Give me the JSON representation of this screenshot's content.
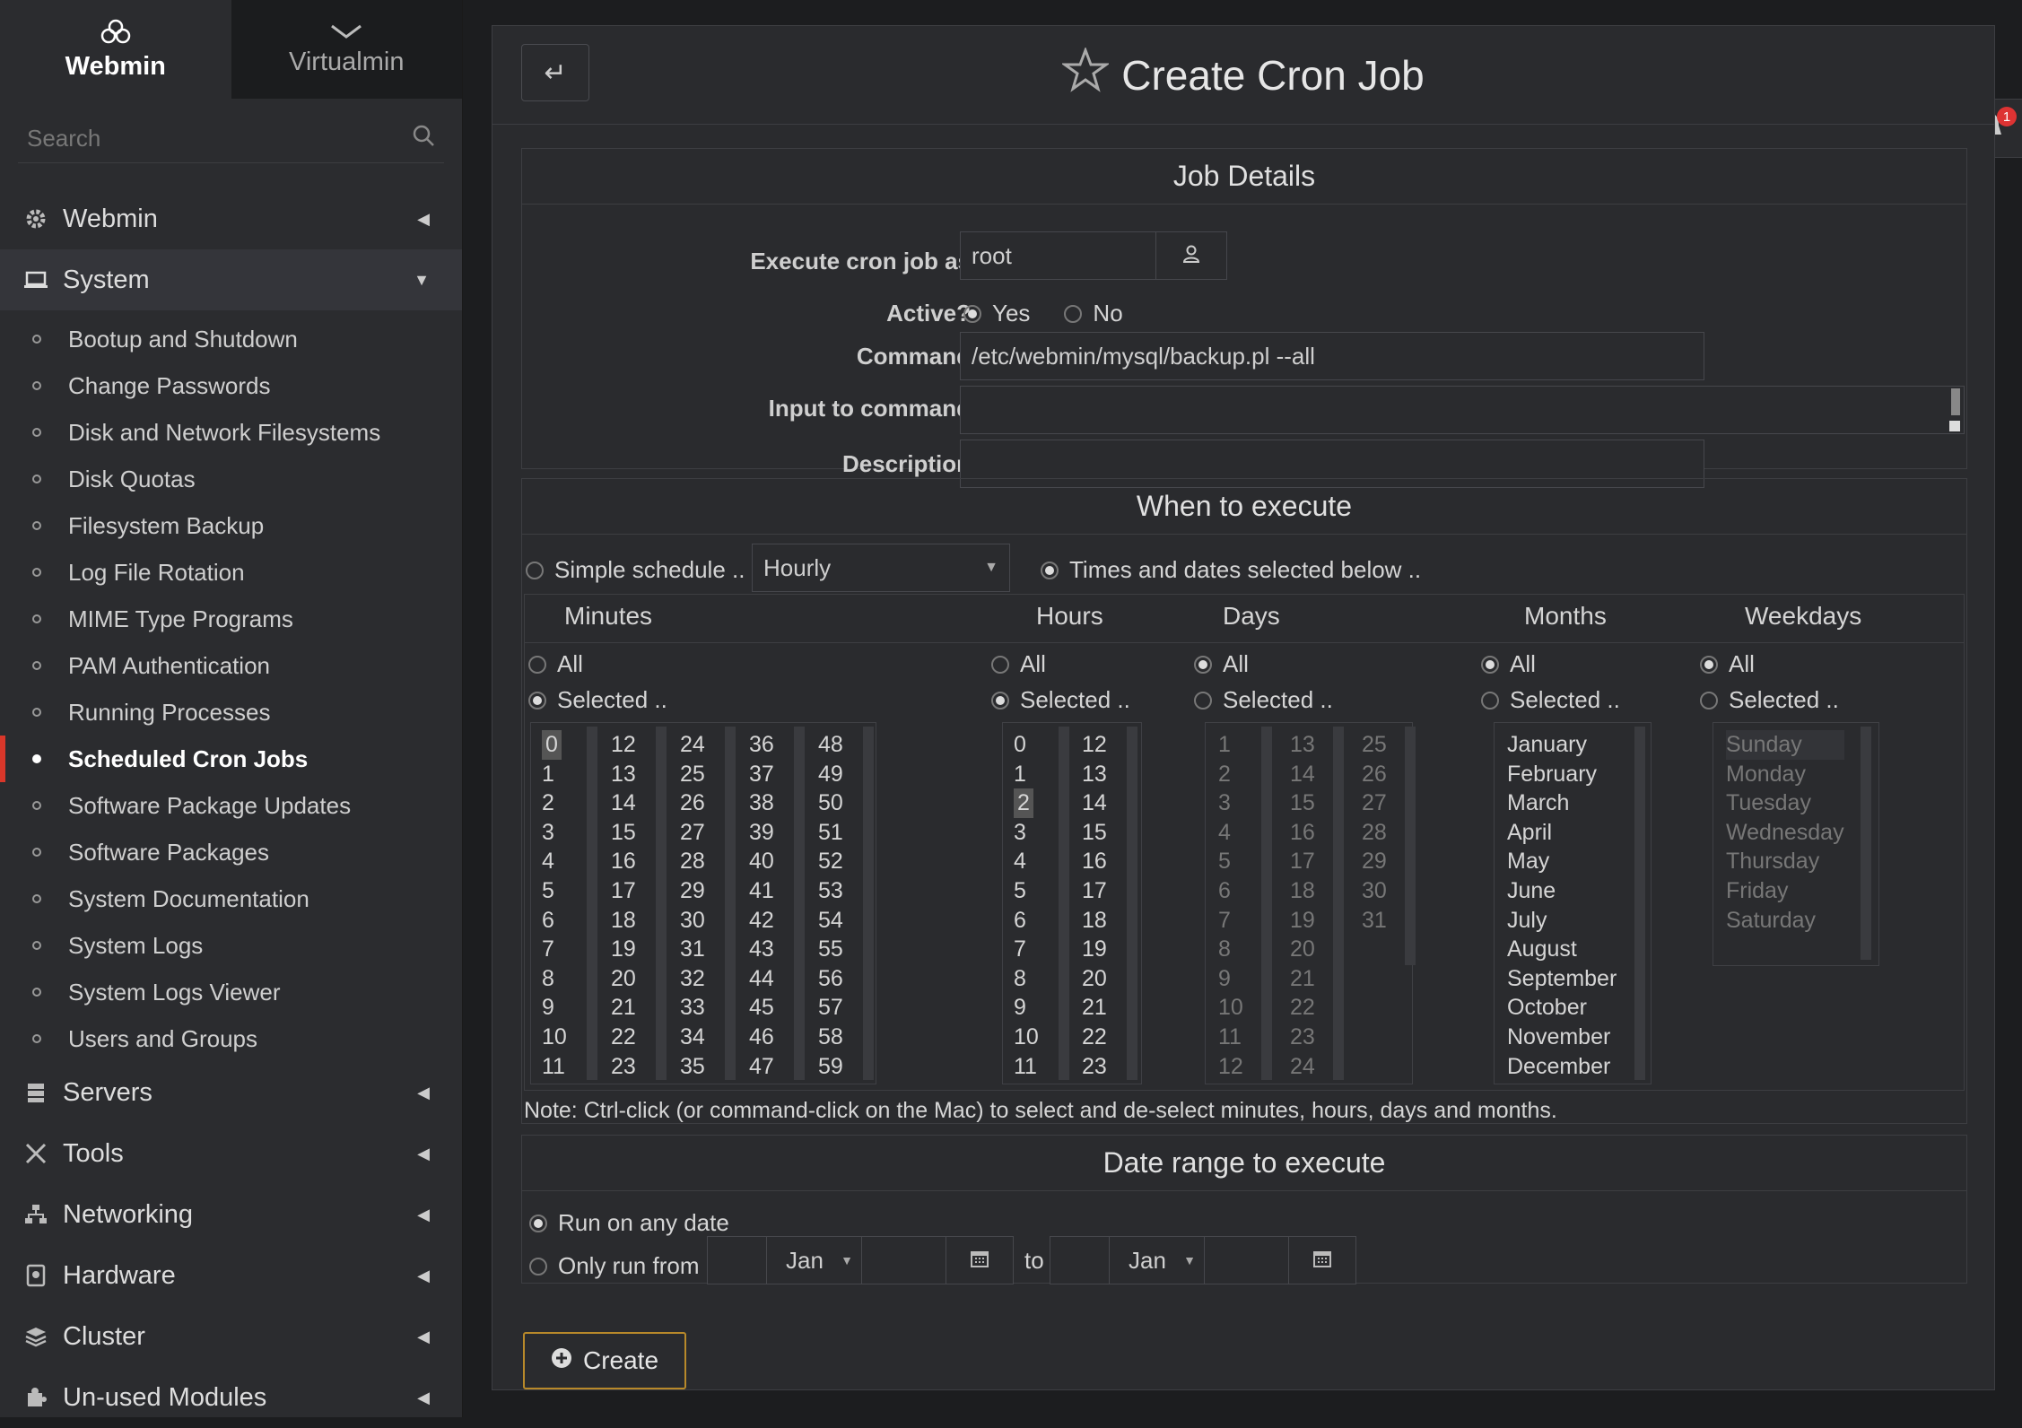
{
  "switcher": {
    "webmin": "Webmin",
    "virtualmin": "Virtualmin"
  },
  "search": {
    "placeholder": "Search"
  },
  "menu": {
    "webmin": "Webmin",
    "system": "System",
    "system_items": [
      "Bootup and Shutdown",
      "Change Passwords",
      "Disk and Network Filesystems",
      "Disk Quotas",
      "Filesystem Backup",
      "Log File Rotation",
      "MIME Type Programs",
      "PAM Authentication",
      "Running Processes",
      "Scheduled Cron Jobs",
      "Software Package Updates",
      "Software Packages",
      "System Documentation",
      "System Logs",
      "System Logs Viewer",
      "Users and Groups"
    ],
    "active_item": "Scheduled Cron Jobs",
    "servers": "Servers",
    "tools": "Tools",
    "networking": "Networking",
    "hardware": "Hardware",
    "cluster": "Cluster",
    "unused": "Un-used Modules"
  },
  "page": {
    "title": "Create Cron Job",
    "notifications": "1"
  },
  "job": {
    "section": "Job Details",
    "exec_as_label": "Execute cron job as",
    "exec_as_value": "root",
    "active_label": "Active?",
    "yes": "Yes",
    "no": "No",
    "command_label": "Command",
    "command_value": "/etc/webmin/mysql/backup.pl --all",
    "input_label": "Input to command",
    "description_label": "Description"
  },
  "when": {
    "section": "When to execute",
    "simple": "Simple schedule ..",
    "simple_value": "Hourly",
    "times": "Times and dates selected below ..",
    "headers": {
      "minutes": "Minutes",
      "hours": "Hours",
      "days": "Days",
      "months": "Months",
      "weekdays": "Weekdays"
    },
    "all": "All",
    "selected": "Selected ..",
    "minutes_cols": [
      [
        "0",
        "1",
        "2",
        "3",
        "4",
        "5",
        "6",
        "7",
        "8",
        "9",
        "10",
        "11"
      ],
      [
        "12",
        "13",
        "14",
        "15",
        "16",
        "17",
        "18",
        "19",
        "20",
        "21",
        "22",
        "23"
      ],
      [
        "24",
        "25",
        "26",
        "27",
        "28",
        "29",
        "30",
        "31",
        "32",
        "33",
        "34",
        "35"
      ],
      [
        "36",
        "37",
        "38",
        "39",
        "40",
        "41",
        "42",
        "43",
        "44",
        "45",
        "46",
        "47"
      ],
      [
        "48",
        "49",
        "50",
        "51",
        "52",
        "53",
        "54",
        "55",
        "56",
        "57",
        "58",
        "59"
      ]
    ],
    "hours_cols": [
      [
        "0",
        "1",
        "2",
        "3",
        "4",
        "5",
        "6",
        "7",
        "8",
        "9",
        "10",
        "11"
      ],
      [
        "12",
        "13",
        "14",
        "15",
        "16",
        "17",
        "18",
        "19",
        "20",
        "21",
        "22",
        "23"
      ]
    ],
    "days_cols": [
      [
        "1",
        "2",
        "3",
        "4",
        "5",
        "6",
        "7",
        "8",
        "9",
        "10",
        "11",
        "12"
      ],
      [
        "13",
        "14",
        "15",
        "16",
        "17",
        "18",
        "19",
        "20",
        "21",
        "22",
        "23",
        "24"
      ],
      [
        "25",
        "26",
        "27",
        "28",
        "29",
        "30",
        "31"
      ]
    ],
    "months": [
      "January",
      "February",
      "March",
      "April",
      "May",
      "June",
      "July",
      "August",
      "September",
      "October",
      "November",
      "December"
    ],
    "weekdays": [
      "Sunday",
      "Monday",
      "Tuesday",
      "Wednesday",
      "Thursday",
      "Friday",
      "Saturday"
    ],
    "selected_minute": "0",
    "selected_hour": "2",
    "note": "Note: Ctrl-click (or command-click on the Mac) to select and de-select minutes, hours, days and months."
  },
  "range": {
    "section": "Date range to execute",
    "any": "Run on any date",
    "only": "Only run from",
    "from_month": "Jan",
    "to": "to",
    "to_month": "Jan"
  },
  "create_label": "Create"
}
